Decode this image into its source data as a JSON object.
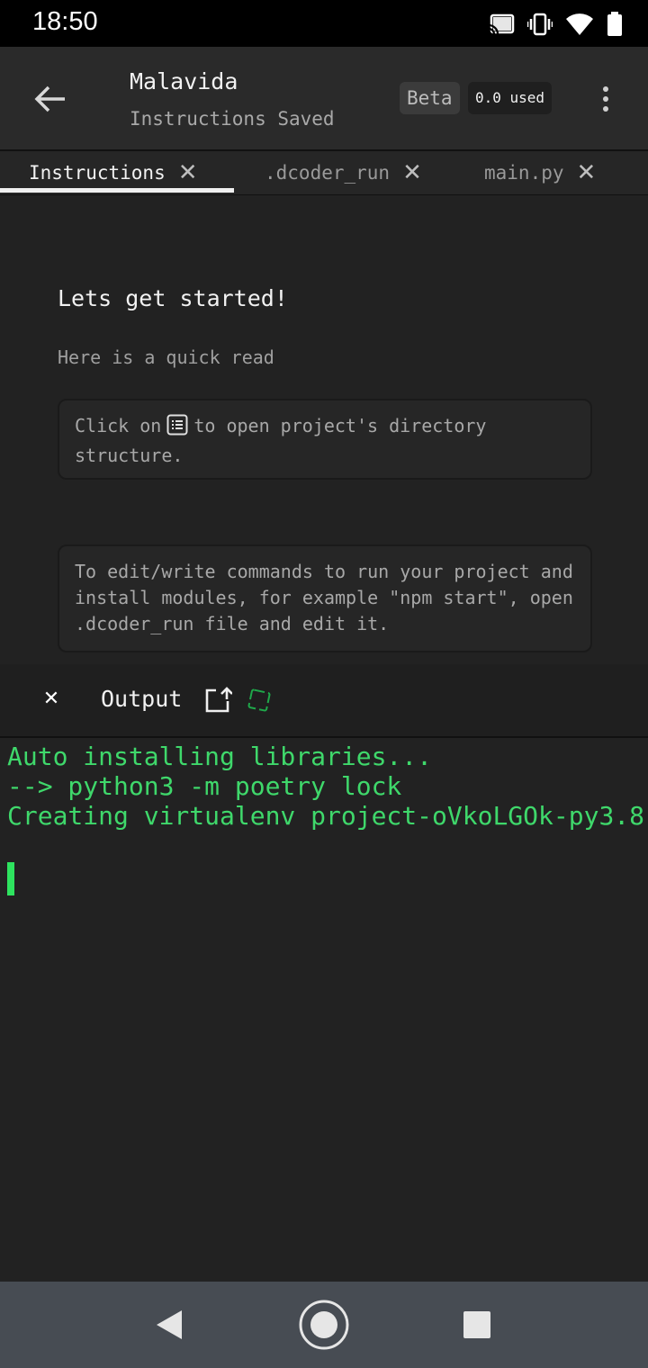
{
  "status_bar": {
    "time": "18:50",
    "icons": [
      "cast-icon",
      "vibrate-icon",
      "wifi-icon",
      "battery-icon"
    ]
  },
  "app_bar": {
    "title": "Malavida",
    "subtitle": "Instructions Saved",
    "beta_label": "Beta",
    "usage_label": "0.0 used"
  },
  "tabs": [
    {
      "label": "Instructions",
      "active": true
    },
    {
      "label": ".dcoder_run",
      "active": false
    },
    {
      "label": "main.py",
      "active": false
    }
  ],
  "tab_close_glyph": "✕",
  "instructions": {
    "heading": "Lets get started!",
    "subheading": "Here is a quick read",
    "card1_before": "Click on",
    "card1_after": "to open project's directory structure.",
    "card2_text": "To edit/write commands to run your project and install modules, for example \"npm start\", open .dcoder_run file and edit it."
  },
  "output_panel": {
    "close_glyph": "✕",
    "label": "Output"
  },
  "terminal": {
    "lines": [
      "Auto installing libraries...",
      "--> python3 -m poetry lock",
      "Creating virtualenv project-oVkoLGOk-py3.8"
    ],
    "text_color": "#3fd86b"
  },
  "nav_bar": {
    "buttons": [
      "back-nav-icon",
      "home-nav-icon",
      "recents-nav-icon"
    ]
  }
}
